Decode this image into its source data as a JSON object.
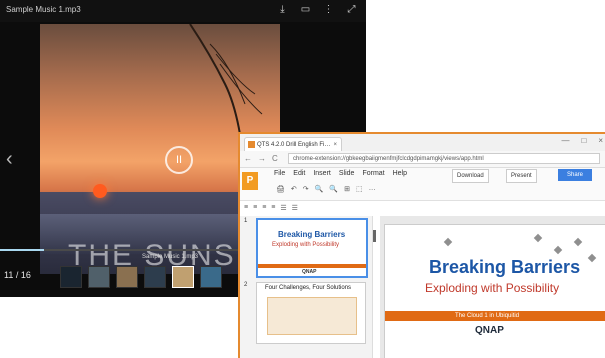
{
  "player": {
    "title": "Sample Music 1.mp3",
    "icons": [
      "download-icon",
      "cast-icon",
      "more-icon",
      "fullscreen-icon"
    ],
    "art_title": "THE SUNSET",
    "play_glyph": "II",
    "progress": 0.12,
    "mini_label": "Sample Music 1.mp3",
    "time_indicator": "11 / 16",
    "thumbnails_count": 6,
    "selected_thumbnail": 4,
    "accent": "#a9d8f0"
  },
  "browser": {
    "tab_title": "QTS 4.2.0 Drill English Fi…",
    "tab_close": "×",
    "window_controls": [
      "—",
      "□",
      "×"
    ],
    "nav": [
      "←",
      "→",
      "C"
    ],
    "url": "chrome-extension://gbkeegbaiigmenfmjfclcdgdpimamgkj/views/app.html",
    "app_logo": "P",
    "menu": [
      "File",
      "Edit",
      "Insert",
      "Slide",
      "Format",
      "Help"
    ],
    "download_label": "Download",
    "present_label": "Present",
    "share_label": "Share",
    "toolbar1": [
      "🖨",
      "↶",
      "↷",
      "🔍",
      "🔍",
      "⊞",
      "⬚",
      "…"
    ],
    "toolbar2": [
      "≡",
      "≡",
      "≡",
      "≡",
      "☰",
      "☰"
    ],
    "slides": [
      {
        "number": "1",
        "title": "Breaking Barriers",
        "subtitle": "Exploding with Possibility",
        "brand": "QNAP"
      },
      {
        "number": "2",
        "title": "Four Challenges, Four Solutions"
      }
    ],
    "main_slide": {
      "title": "Breaking Barriers",
      "subtitle": "Exploding with Possibility",
      "bar_text": "The Cloud 1 in Ubiquitid",
      "brand": "QNAP"
    },
    "accent": "#e58a2f",
    "share_color": "#3b7fe0"
  }
}
